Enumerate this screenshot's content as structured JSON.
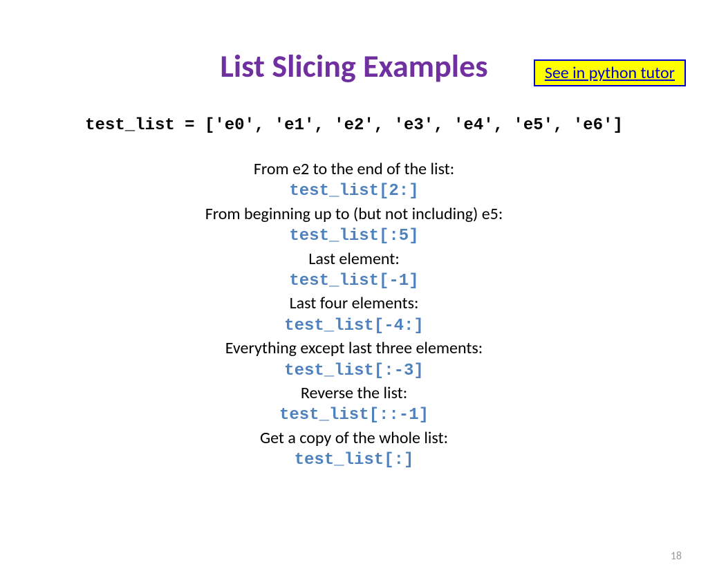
{
  "header": {
    "tutor_link": "See in python tutor",
    "title": "List Slicing Examples"
  },
  "body": {
    "declaration": "test_list = ['e0', 'e1', 'e2', 'e3', 'e4', 'e5', 'e6']",
    "examples": [
      {
        "desc": "From e2 to the end of the list:",
        "code": "test_list[2:]"
      },
      {
        "desc": "From beginning up to (but not including) e5:",
        "code": "test_list[:5]"
      },
      {
        "desc": "Last element:",
        "code": "test_list[-1]"
      },
      {
        "desc": "Last four elements:",
        "code": "test_list[-4:]"
      },
      {
        "desc": "Everything except last three elements:",
        "code": "test_list[:-3]"
      },
      {
        "desc": "Reverse the list:",
        "code": "test_list[::-1]"
      },
      {
        "desc": "Get a copy of the whole list:",
        "code": "test_list[:]"
      }
    ]
  },
  "footer": {
    "page_number": "18"
  }
}
